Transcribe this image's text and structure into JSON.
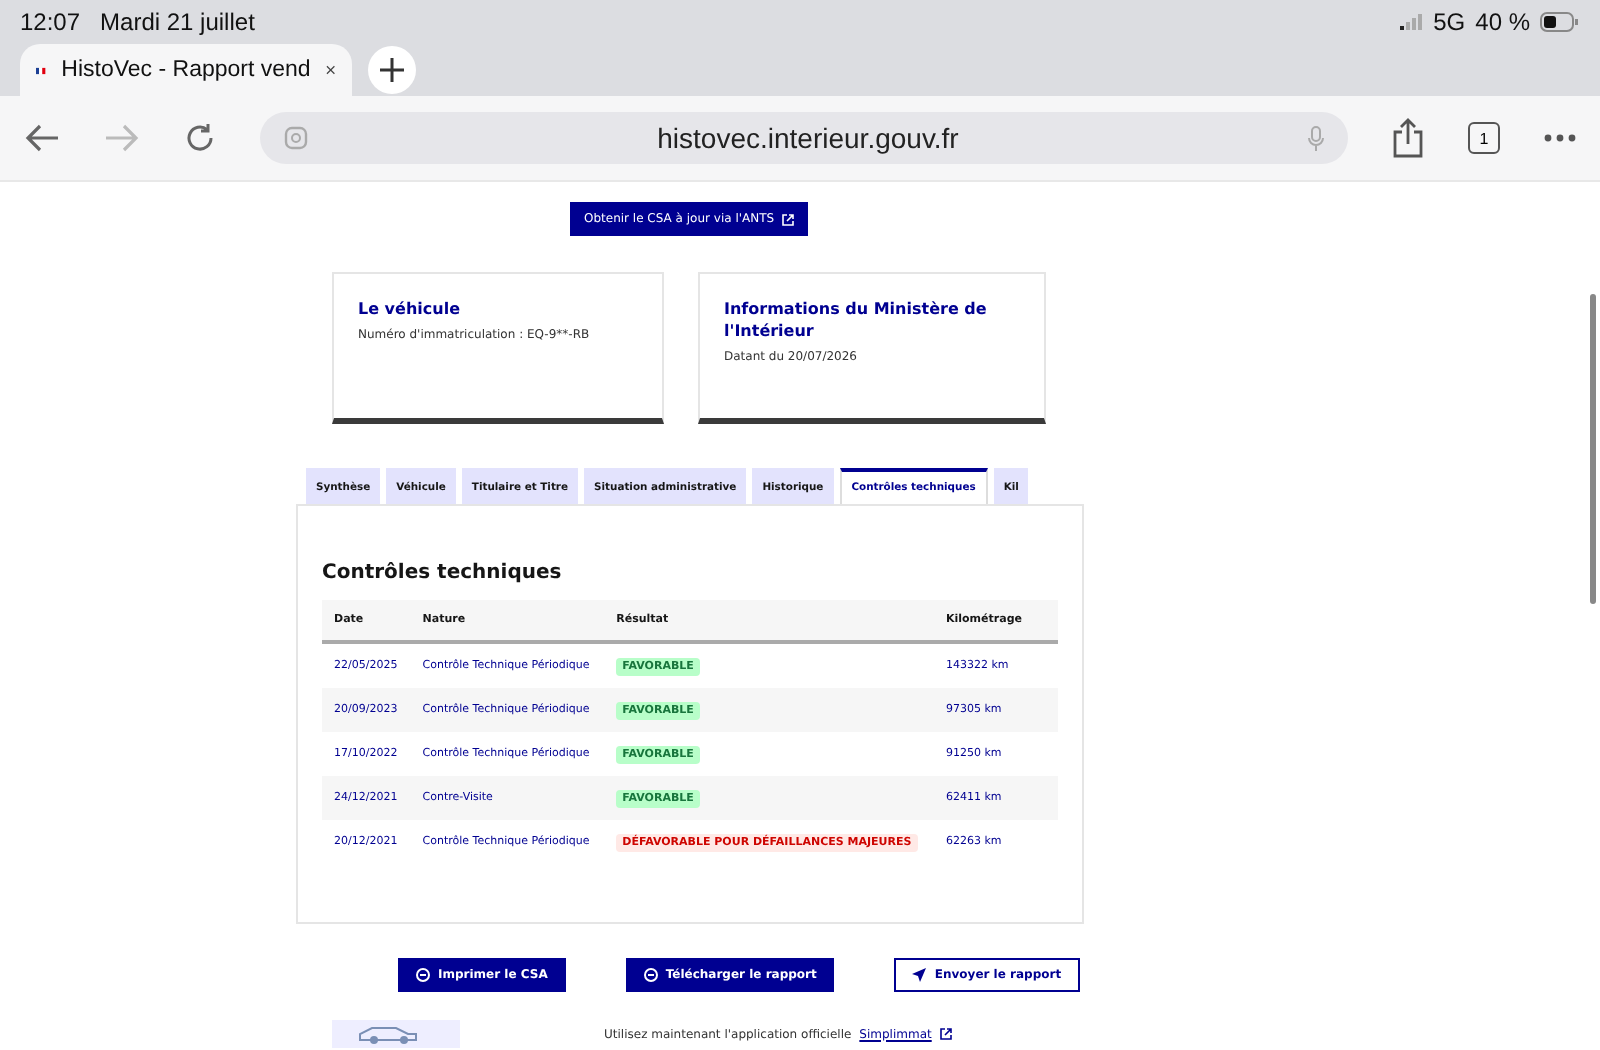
{
  "status_bar": {
    "time": "12:07",
    "date": "Mardi 21 juillet",
    "network": "5G",
    "battery": "40 %"
  },
  "browser": {
    "tab_title": "HistoVec - Rapport vend",
    "url": "histovec.interieur.gouv.fr",
    "tab_count": "1"
  },
  "ants_button": "Obtenir le CSA à jour via l'ANTS",
  "cards": [
    {
      "title": "Le véhicule",
      "text": "Numéro d'immatriculation : EQ-9**-RB"
    },
    {
      "title": "Informations du Ministère de l'Intérieur",
      "text": "Datant du 20/07/2026"
    }
  ],
  "tabs": [
    {
      "label": "Synthèse",
      "selected": false
    },
    {
      "label": "Véhicule",
      "selected": false
    },
    {
      "label": "Titulaire et Titre",
      "selected": false
    },
    {
      "label": "Situation administrative",
      "selected": false
    },
    {
      "label": "Historique",
      "selected": false
    },
    {
      "label": "Contrôles techniques",
      "selected": true
    },
    {
      "label": "Kil",
      "selected": false
    }
  ],
  "section_title": "Contrôles techniques",
  "table": {
    "columns": [
      "Date",
      "Nature",
      "Résultat",
      "Kilométrage"
    ],
    "rows": [
      {
        "date": "22/05/2025",
        "nature": "Contrôle Technique Périodique",
        "result": "FAVORABLE",
        "kind": "favorable",
        "km": "143322 km"
      },
      {
        "date": "20/09/2023",
        "nature": "Contrôle Technique Périodique",
        "result": "FAVORABLE",
        "kind": "favorable",
        "km": "97305 km"
      },
      {
        "date": "17/10/2022",
        "nature": "Contrôle Technique Périodique",
        "result": "FAVORABLE",
        "kind": "favorable",
        "km": "91250 km"
      },
      {
        "date": "24/12/2021",
        "nature": "Contre-Visite",
        "result": "FAVORABLE",
        "kind": "favorable",
        "km": "62411 km"
      },
      {
        "date": "20/12/2021",
        "nature": "Contrôle Technique Périodique",
        "result": "DÉFAVORABLE POUR DÉFAILLANCES MAJEURES",
        "kind": "defavorable",
        "km": "62263 km"
      }
    ]
  },
  "actions": [
    {
      "label": "Imprimer le CSA",
      "kind": "primary"
    },
    {
      "label": "Télécharger le rapport",
      "kind": "primary"
    },
    {
      "label": "Envoyer le rapport",
      "kind": "secondary"
    }
  ],
  "footer": {
    "text": "Utilisez maintenant l'application officielle",
    "link": "Simplimmat"
  }
}
